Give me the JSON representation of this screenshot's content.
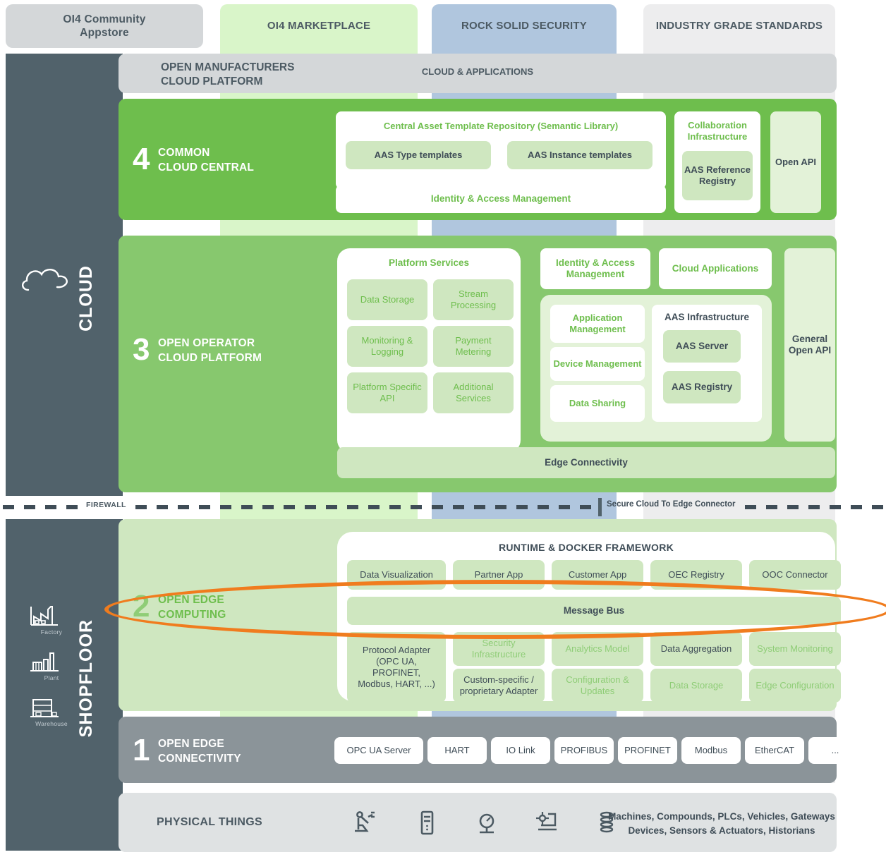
{
  "theme_columns": [
    {
      "key": "appstore",
      "label": "OI4 Community\nAppstore",
      "color": "#d4d7d9"
    },
    {
      "key": "marketplace",
      "label": "OI4 MARKETPLACE",
      "color": "#d9f5c9"
    },
    {
      "key": "security",
      "label": "ROCK SOLID SECURITY",
      "color": "#b0c6de"
    },
    {
      "key": "standards",
      "label": "INDUSTRY GRADE STANDARDS",
      "color": "#ededee"
    }
  ],
  "rail": {
    "cloud_label": "CLOUD",
    "shopfloor_label": "SHOPFLOOR",
    "cloud_icon": "cloud-icon",
    "shopfloor_icons": [
      {
        "icon": "factory-icon",
        "label": "Factory"
      },
      {
        "icon": "plant-icon",
        "label": "Plant"
      },
      {
        "icon": "warehouse-icon",
        "label": "Warehouse"
      }
    ]
  },
  "cloud_applications_band": {
    "left_title": "OPEN MANUFACTURERS\nCLOUD PLATFORM",
    "center_title": "CLOUD & APPLICATIONS"
  },
  "layer4": {
    "number": "4",
    "title": "COMMON\nCLOUD CENTRAL",
    "repository_title": "Central Asset Template Repository (Semantic Library)",
    "repository_items": [
      "AAS Type templates",
      "AAS Instance templates"
    ],
    "iam": "Identity & Access Management",
    "collaboration_title": "Collaboration\nInfrastructure",
    "collaboration_item": "AAS Reference\nRegistry",
    "open_api": "Open API"
  },
  "layer3": {
    "number": "3",
    "title": "OPEN OPERATOR\nCLOUD PLATFORM",
    "platform_services_title": "Platform Services",
    "platform_services": [
      "Data Storage",
      "Stream\nProcessing",
      "Monitoring &\nLogging",
      "Payment\nMetering",
      "Platform Specific\nAPI",
      "Additional\nServices"
    ],
    "iam": "Identity & Access\nManagement",
    "cloud_applications": "Cloud Applications",
    "management_items": [
      "Application\nManagement",
      "Device Management",
      "Data Sharing"
    ],
    "aas_infrastructure_title": "AAS Infrastructure",
    "aas_infrastructure_items": [
      "AAS Server",
      "AAS Registry"
    ],
    "general_open_api": "General\nOpen API",
    "edge_connectivity": "Edge Connectivity"
  },
  "firewall": {
    "label": "FIREWALL",
    "connector_label": "Secure Cloud To Edge Connector"
  },
  "layer2": {
    "number": "2",
    "title": "OPEN EDGE\nCOMPUTING",
    "runtime_title": "RUNTIME & DOCKER FRAMEWORK",
    "apps_row": [
      {
        "label": "Data Visualization",
        "muted": false
      },
      {
        "label": "Partner App",
        "muted": false
      },
      {
        "label": "Customer App",
        "muted": false
      },
      {
        "label": "OEC Registry",
        "muted": false
      },
      {
        "label": "OOC Connector",
        "muted": false
      }
    ],
    "message_bus": "Message Bus",
    "protocol_adapter": "Protocol Adapter\n(OPC UA,\nPROFINET,\nModbus, HART, ...)",
    "services_row1": [
      {
        "label": "Security\nInfrastructure",
        "muted": true
      },
      {
        "label": "Analytics Model",
        "muted": true
      },
      {
        "label": "Data Aggregation",
        "muted": false
      },
      {
        "label": "System Monitoring",
        "muted": true
      }
    ],
    "services_row2": [
      {
        "label": "Custom-specific /\nproprietary Adapter",
        "muted": false
      },
      {
        "label": "Configuration &\nUpdates",
        "muted": true
      },
      {
        "label": "Data Storage",
        "muted": true
      },
      {
        "label": "Edge Configuration",
        "muted": true
      }
    ],
    "highlight_color": "#f07c1e"
  },
  "layer1": {
    "number": "1",
    "title": "OPEN EDGE\nCONNECTIVITY",
    "protocols": [
      "OPC UA Server",
      "HART",
      "IO Link",
      "PROFIBUS",
      "PROFINET",
      "Modbus",
      "EtherCAT",
      "..."
    ]
  },
  "physical_things": {
    "title": "PHYSICAL THINGS",
    "icons": [
      "robot-arm-icon",
      "server-cabinet-icon",
      "sensor-gauge-icon",
      "machine-tool-icon",
      "coil-stack-icon"
    ],
    "description": "Machines, Compounds, PLCs, Vehicles, Gateways\nDevices, Sensors & Actuators, Historians"
  },
  "colors": {
    "dark_rail": "#51626b",
    "green_l4": "#6ebe4d",
    "green_l3": "#87c86e",
    "pale_green": "#cfe7c0",
    "gray_l1": "#8b9499",
    "orange": "#f07c1e",
    "blue_security": "#b0c6de"
  }
}
